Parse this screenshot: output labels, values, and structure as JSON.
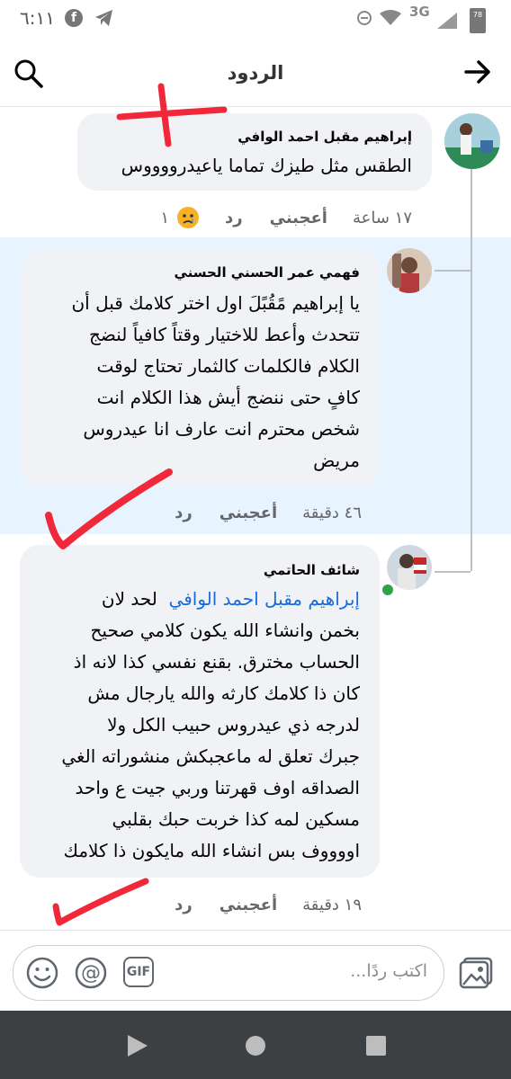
{
  "status_bar": {
    "time": "٦:١١",
    "network": "3G",
    "battery": "78"
  },
  "header": {
    "title": "الردود"
  },
  "comments": [
    {
      "author": "إبراهيم مقبل احمد الوافي",
      "text": "الطقس مثل طيزك تماما ياعيدرووووس",
      "time": "١٧ ساعة",
      "like_label": "أعجبني",
      "reply_label": "رد",
      "reaction_icon": "sad-face-emoji",
      "reaction_count": "١"
    },
    {
      "author": "فهمي عمر الحسني الحسني",
      "text_lines": [
        "يا إبراهيم مًقُبًلَ اول اختر كلامك قبل أن",
        "تتحدث وأعط للاختيار وقتاً كافياً لنضج",
        "الكلام فالكلمات كالثمار تحتاج لوقت",
        "كافٍ حتى ننضج أيش هذا الكلام انت",
        "شخص محترم انت عارف انا عيدروس",
        "مريض"
      ],
      "time": "٤٦ دقيقة",
      "like_label": "أعجبني",
      "reply_label": "رد"
    },
    {
      "author": "شائف الحاتمي",
      "mention": "إبراهيم مقبل احمد الوافي",
      "first_line_rest": "لحد لان",
      "text_lines": [
        "بخمن وانشاء الله يكون كلامي صحيح",
        "الحساب مخترق.  بقنع نفسي كذا لانه اذ",
        "كان ذا كلامك كارثه والله يارجال مش",
        "لدرجه ذي عيدروس حبيب الكل ولا",
        "جبرك تعلق له ماعجبكش منشوراته الغي",
        "الصداقه اوف قهرتنا وربي جيت ع واحد",
        "مسكين لمه كذا خربت حبك بقلبي",
        "اووووف بس انشاء الله مايكون ذا كلامك"
      ],
      "time": "١٩ دقيقة",
      "like_label": "أعجبني",
      "reply_label": "رد"
    }
  ],
  "composer": {
    "placeholder": "اكتب ردًا...",
    "gif_label": "GIF"
  },
  "colors": {
    "highlight_bg": "#e7f3ff",
    "bubble_bg": "#f0f2f5",
    "mention": "#1a6bd8",
    "annotation_red": "#f0283a",
    "nav_bar": "#3c4043"
  }
}
